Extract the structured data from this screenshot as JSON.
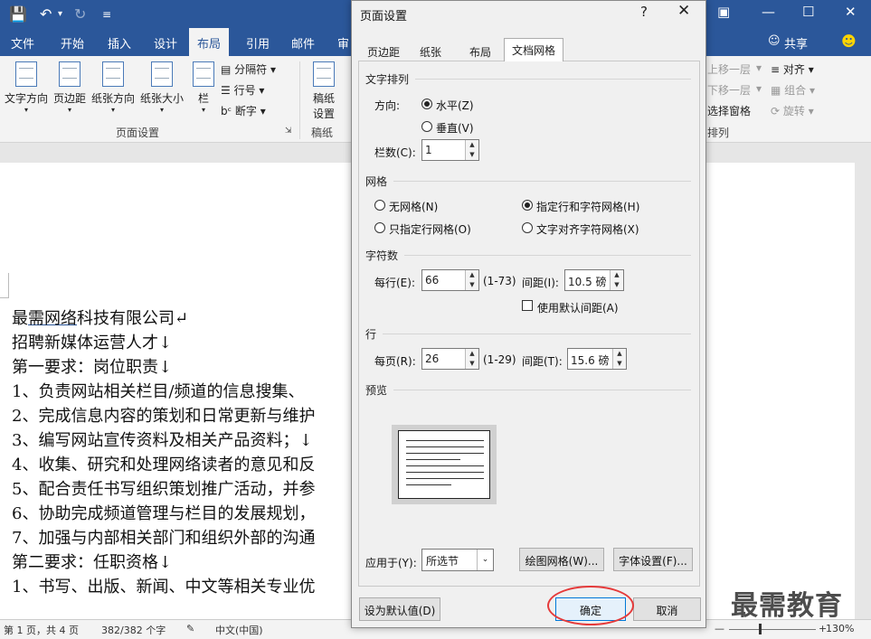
{
  "titlebar": {
    "right_controls": [
      "☐",
      "—",
      "☐",
      "✕"
    ]
  },
  "tabs": [
    "文件",
    "开始",
    "插入",
    "设计",
    "布局",
    "引用",
    "邮件",
    "审"
  ],
  "active_tab": "布局",
  "share_label": "共享",
  "ribbon": {
    "buttons": [
      "文字方向",
      "页边距",
      "纸张方向",
      "纸张大小",
      "栏"
    ],
    "small_items": [
      "分隔符",
      "行号",
      "断字"
    ],
    "draft": [
      "稿纸",
      "设置"
    ],
    "group_page_setup": "页面设置",
    "group_draft": "稿纸",
    "right_items": [
      "上移一层",
      "下移一层",
      "选择窗格",
      "对齐",
      "组合",
      "旋转"
    ],
    "group_arrange_partial": "排列"
  },
  "document": {
    "lines": [
      "最需网络科技有限公司↵",
      "招聘新媒体运营人才↓",
      "第一要求：岗位职责↓",
      "1、负责网站相关栏目/频道的信息搜集、",
      "2、完成信息内容的策划和日常更新与维护",
      "3、编写网站宣传资料及相关产品资料；↓",
      "4、收集、研究和处理网络读者的意见和反",
      "5、配合责任书写组织策划推广活动，并参",
      "6、协助完成频道管理与栏目的发展规划，",
      "7、加强与内部相关部门和组织外部的沟通",
      "第二要求：任职资格↓",
      "1、书写、出版、新闻、中文等相关专业优"
    ]
  },
  "statusbar": {
    "page": "第 1 页，共 4 页",
    "words": "382/382 个字",
    "lang": "中文(中国)",
    "zoom": "130%"
  },
  "watermark": "最需教育",
  "dialog": {
    "title": "页面设置",
    "help": "?",
    "close": "✕",
    "tabs": [
      "页边距",
      "纸张",
      "布局",
      "文档网格"
    ],
    "active_tab": "文档网格",
    "text_arrangement": {
      "section": "文字排列",
      "direction_label": "方向:",
      "horizontal": "水平(Z)",
      "vertical": "垂直(V)",
      "columns_label": "栏数(C):",
      "columns_value": "1"
    },
    "grid": {
      "section": "网格",
      "no_grid": "无网格(N)",
      "line_and_char": "指定行和字符网格(H)",
      "line_only": "只指定行网格(O)",
      "snap_chars": "文字对齐字符网格(X)"
    },
    "chars": {
      "section": "字符数",
      "per_line_label": "每行(E):",
      "per_line_value": "66",
      "per_line_range": "(1-73)",
      "pitch_label": "间距(I):",
      "pitch_value": "10.5 磅",
      "default_pitch": "使用默认间距(A)"
    },
    "lines": {
      "section": "行",
      "per_page_label": "每页(R):",
      "per_page_value": "26",
      "per_page_range": "(1-29)",
      "pitch_label": "间距(T):",
      "pitch_value": "15.6 磅"
    },
    "preview_section": "预览",
    "apply_label": "应用于(Y):",
    "apply_value": "所选节",
    "draw_grid": "绘图网格(W)...",
    "font_settings": "字体设置(F)...",
    "set_default": "设为默认值(D)",
    "ok": "确定",
    "cancel": "取消"
  }
}
